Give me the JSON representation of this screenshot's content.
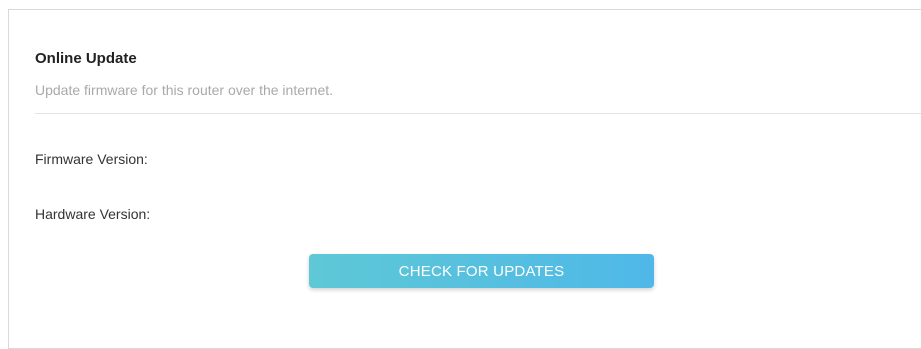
{
  "section": {
    "title": "Online Update",
    "subtitle": "Update firmware for this router over the internet."
  },
  "fields": {
    "firmware_label": "Firmware Version:",
    "firmware_value": "",
    "hardware_label": "Hardware Version:",
    "hardware_value": ""
  },
  "actions": {
    "check_label": "CHECK FOR UPDATES"
  },
  "colors": {
    "button_start": "#5ec8d6",
    "button_end": "#4fb8e8",
    "subtitle": "#a9a9a9"
  }
}
